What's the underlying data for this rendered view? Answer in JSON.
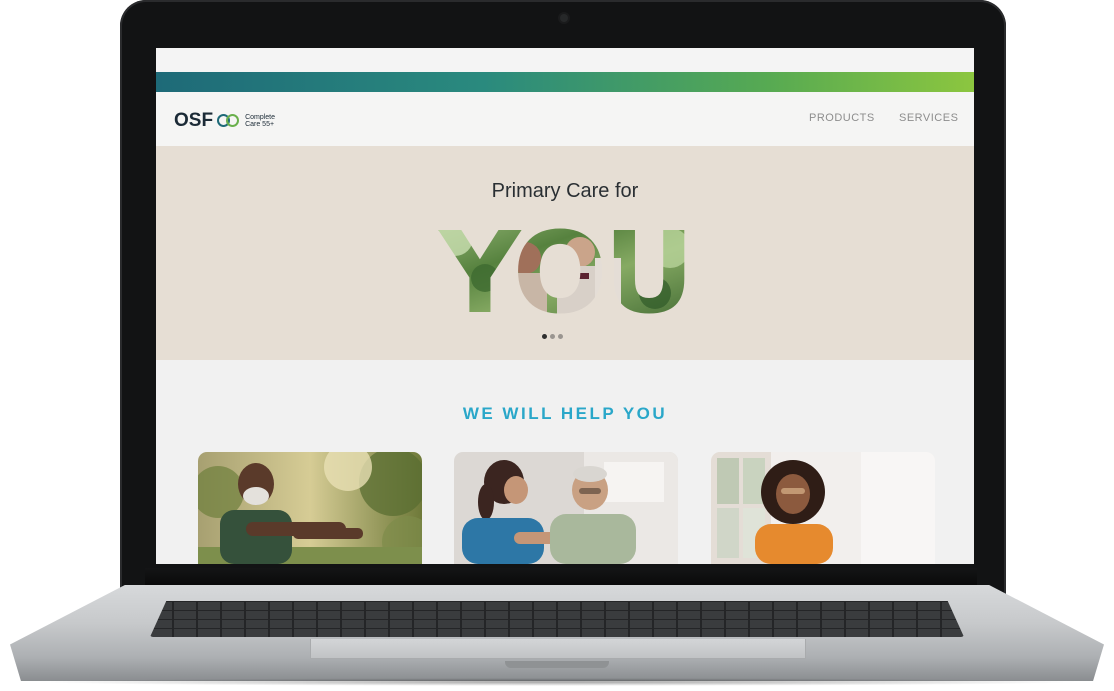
{
  "header": {
    "logo_brand": "OSF",
    "logo_line1": "Complete",
    "logo_line2": "Care 55+",
    "nav": [
      {
        "label": "PRODUCTS"
      },
      {
        "label": "SERVICES"
      }
    ]
  },
  "hero": {
    "title": "Primary Care for",
    "big_word": "YOU",
    "slides": {
      "count": 3,
      "active": 1
    }
  },
  "help_section": {
    "title": "WE WILL HELP YOU",
    "cards": [
      {
        "image": "senior man stretching outdoors"
      },
      {
        "image": "nurse helping senior man"
      },
      {
        "image": "smiling woman in orange top"
      }
    ]
  },
  "colors": {
    "brand_dark": "#1b2a36",
    "gradient_start": "#1e6a78",
    "gradient_end": "#8cc63f",
    "hero_bg": "#e6ded4",
    "accent_blue": "#2aa7c9"
  }
}
